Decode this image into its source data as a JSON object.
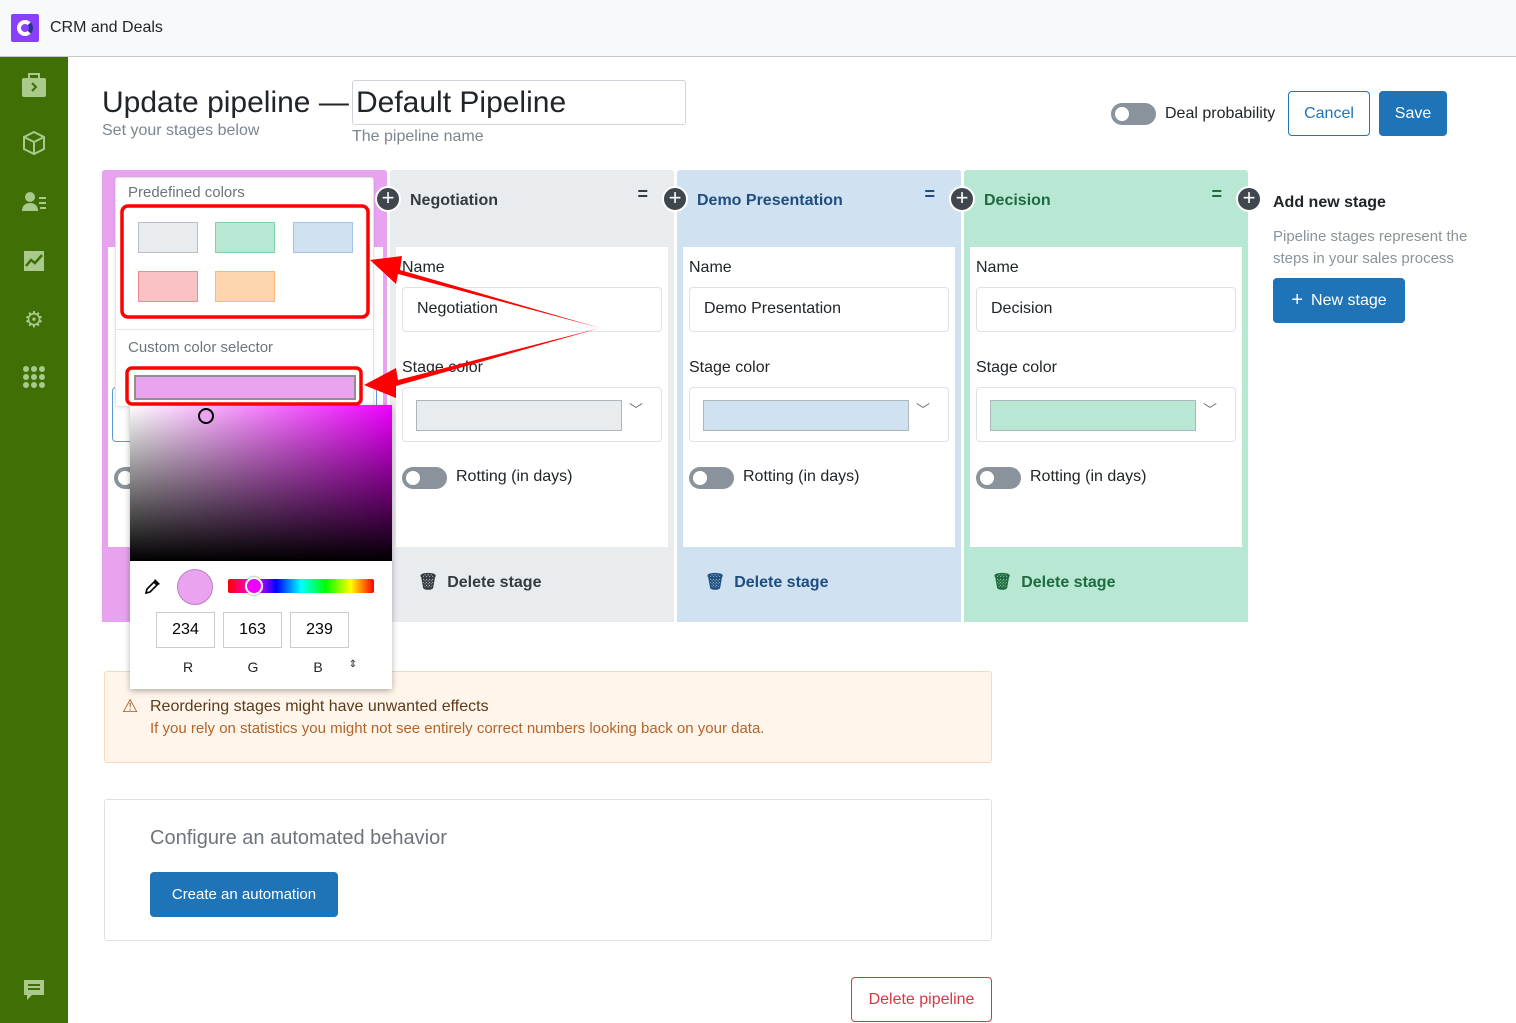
{
  "app": {
    "title": "CRM and Deals",
    "logo": "crm-logo"
  },
  "sidebar": {
    "items": [
      {
        "icon": "briefcase-icon",
        "label": ""
      },
      {
        "icon": "cube-icon"
      },
      {
        "icon": "contacts-icon"
      },
      {
        "icon": "chart-icon"
      },
      {
        "icon": "gear-icon"
      },
      {
        "icon": "apps-grid-icon"
      }
    ],
    "footer_icon": "chat-icon"
  },
  "header": {
    "title": "Update pipeline —",
    "subtitle": "Set your stages below",
    "pipeline_name": "Default Pipeline",
    "pipeline_name_help": "The pipeline name",
    "deal_probability_label": "Deal probability",
    "deal_probability_on": false,
    "cancel_label": "Cancel",
    "save_label": "Save"
  },
  "stages": [
    {
      "title": "",
      "color": "#e7a3ef"
    },
    {
      "title": "Negotiation",
      "name_label": "Name",
      "name_value": "Negotiation",
      "color_label": "Stage color",
      "color": "#e9ecef",
      "swatch": "#e9ecef",
      "rotting_label": "Rotting (in days)",
      "rotting_on": false,
      "delete_label": "Delete stage",
      "text_color": "#343a40"
    },
    {
      "title": "Demo Presentation",
      "name_label": "Name",
      "name_value": "Demo Presentation",
      "color_label": "Stage color",
      "color": "#d0e1f2",
      "swatch": "#d0e1f2",
      "rotting_label": "Rotting (in days)",
      "rotting_on": false,
      "delete_label": "Delete stage",
      "text_color": "#1e4e80"
    },
    {
      "title": "Decision",
      "name_label": "Name",
      "name_value": "Decision",
      "color_label": "Stage color",
      "color": "#b8e8d3",
      "swatch": "#b8e8d3",
      "rotting_label": "Rotting (in days)",
      "rotting_on": false,
      "delete_label": "Delete stage",
      "text_color": "#1d6b3f"
    }
  ],
  "color_popover": {
    "predefined_label": "Predefined colors",
    "predefined": [
      "#e9ecef",
      "#b8e8d3",
      "#d0e1f2",
      "#f9c2c4",
      "#ffd5b0"
    ],
    "custom_label": "Custom color selector",
    "custom_color": "#e9a3ef",
    "r": "234",
    "g": "163",
    "b": "239",
    "r_label": "R",
    "g_label": "G",
    "b_label": "B"
  },
  "add_stage": {
    "title": "Add new stage",
    "description": "Pipeline stages represent the steps in your sales process",
    "button": "New stage"
  },
  "warning": {
    "title": "Reordering stages might have unwanted effects",
    "text": "If you rely on statistics you might not see entirely correct numbers looking back on your data."
  },
  "automation": {
    "title": "Configure an automated behavior",
    "button": "Create an automation"
  },
  "delete_pipeline": "Delete pipeline"
}
